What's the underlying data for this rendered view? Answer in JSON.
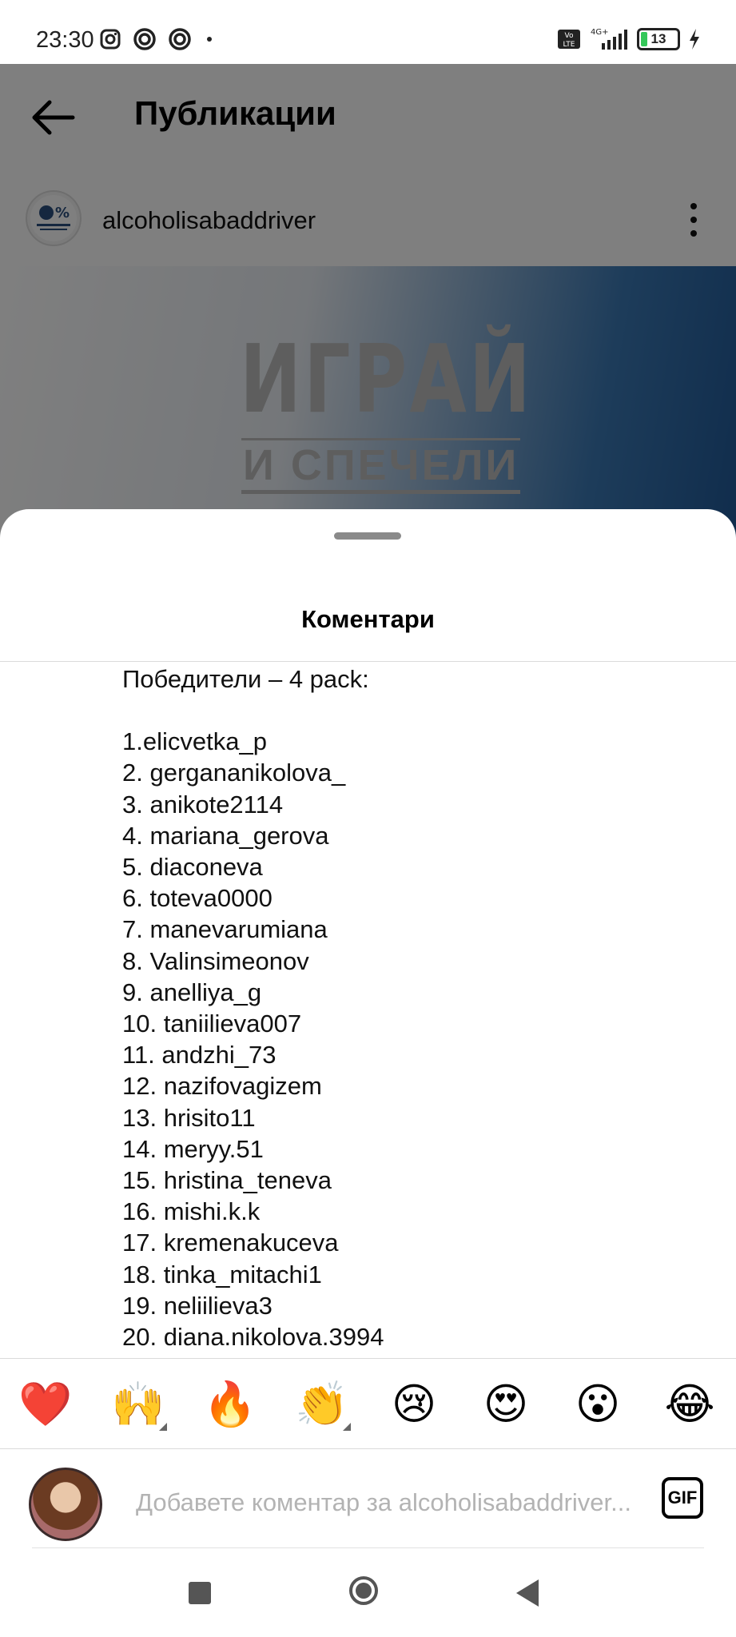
{
  "status_bar": {
    "time": "23:30",
    "network": "4G+",
    "battery": "13",
    "volte": "Vo LTE"
  },
  "header": {
    "title": "Публикации"
  },
  "post": {
    "username": "alcoholisabaddriver",
    "image_text_big": "ИГРАЙ",
    "image_text_small": "И СПЕЧЕЛИ"
  },
  "comments_sheet": {
    "title": "Коментари",
    "comment_heading": "Победители – 4 pack:",
    "winners": [
      "1.elicvetka_p",
      "2. gergananikolova_",
      "3. anikote2114",
      "4. mariana_gerova",
      "5. diaconeva",
      "6. toteva0000",
      "7. manevarumiana",
      "8. Valinsimeonov",
      "9. anelliya_g",
      "10. taniilieva007",
      "11. andzhi_73",
      "12. nazifovagizem",
      "13. hrisito11",
      "14. meryy.51",
      "15. hristina_teneva",
      "16. mishi.k.k",
      "17. kremenakuceva",
      "18. tinka_mitachi1",
      "19. neliilieva3",
      "20. diana.nikolova.3994"
    ]
  },
  "reactions": [
    "❤️",
    "🙌",
    "🔥",
    "👏",
    "😢",
    "😍",
    "😮",
    "😂"
  ],
  "composer": {
    "placeholder": "Добавете коментар за alcoholisabaddriver...",
    "gif_label": "GIF"
  },
  "icons": {
    "back": "arrow-left-icon",
    "more": "more-vertical-icon",
    "nav_recent": "square-icon",
    "nav_home": "circle-icon",
    "nav_back": "triangle-back-icon"
  },
  "colors": {
    "overlay": "#808080",
    "sheet": "#ffffff",
    "divider": "#dbdbdb",
    "image_blue": "#215a99"
  }
}
